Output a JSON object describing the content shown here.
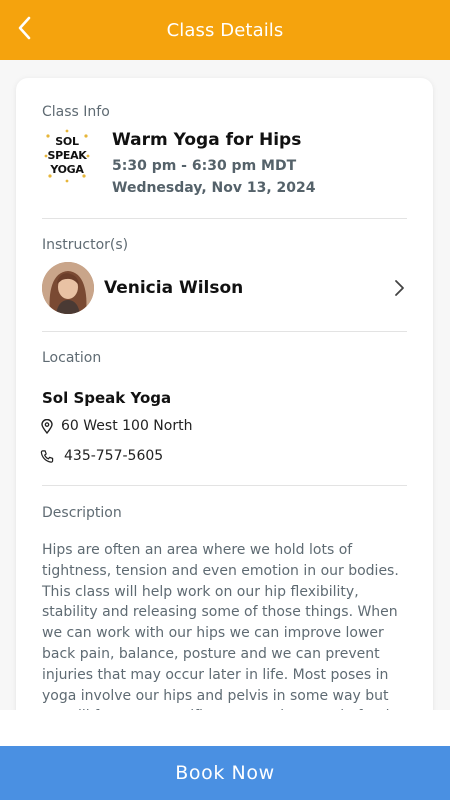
{
  "header": {
    "title": "Class Details",
    "back_icon": "chevron-left-icon",
    "background": "#f5a30d"
  },
  "class_info": {
    "section_label": "Class Info",
    "logo_lines": [
      "SOL",
      "SPEAK",
      "YOGA"
    ],
    "name": "Warm Yoga for Hips",
    "time": "5:30 pm - 6:30 pm MDT",
    "date": "Wednesday, Nov 13, 2024"
  },
  "instructors": {
    "section_label": "Instructor(s)",
    "items": [
      {
        "name": "Venicia Wilson"
      }
    ]
  },
  "location": {
    "section_label": "Location",
    "name": "Sol Speak Yoga",
    "address": "60 West 100 North",
    "phone": "435-757-5605"
  },
  "description": {
    "section_label": "Description",
    "text": "Hips are often an area where we hold lots of tightness, tension and even emotion in our bodies. This class will help work on our hip flexibility, stability and releasing some of those things. When we can work with our hips we can improve lower back pain, balance, posture and we can prevent injuries that may occur later in life. Most poses in yoga involve our hips and pelvis in some way but we will focus on specific asanas whose main funtion is to"
  },
  "actions": {
    "book_label": "Book Now",
    "book_color": "#4a90e2"
  }
}
